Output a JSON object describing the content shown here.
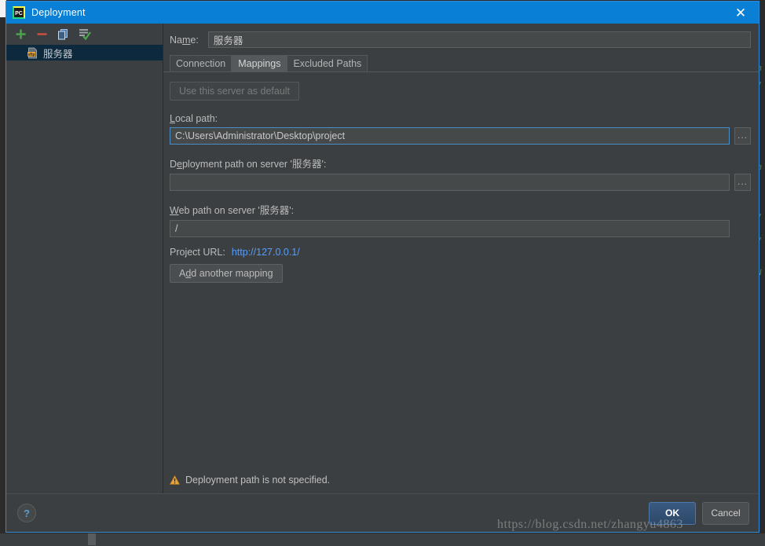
{
  "window": {
    "title": "Deployment",
    "app_icon": "pycharm-icon",
    "close_label": "✕"
  },
  "sidebar": {
    "toolbar": [
      {
        "name": "add-button",
        "label": "+"
      },
      {
        "name": "remove-button",
        "label": "−"
      },
      {
        "name": "copy-button",
        "label": "copy"
      },
      {
        "name": "set-default-button",
        "label": "set-default"
      }
    ],
    "servers": [
      {
        "label": "服务器",
        "icon": "sftp-icon",
        "selected": true
      }
    ]
  },
  "form": {
    "name_label_pre": "Na",
    "name_label_mn": "m",
    "name_label_post": "e:",
    "name_value": "服务器",
    "name_placeholder": ""
  },
  "tabs": [
    {
      "label": "Connection",
      "selected": false
    },
    {
      "label": "Mappings",
      "selected": true
    },
    {
      "label": "Excluded Paths",
      "selected": false
    }
  ],
  "mappings": {
    "use_default_button": "Use this server as default",
    "local_path": {
      "label_pre": "",
      "label_mn": "L",
      "label_post": "ocal path:",
      "value": "C:\\Users\\Administrator\\Desktop\\project",
      "browse_label": "..."
    },
    "deployment_path": {
      "label_pre": "D",
      "label_mn": "e",
      "label_post": "ployment path on server '服务器':",
      "value": "",
      "browse_label": "..."
    },
    "web_path": {
      "label_pre": "",
      "label_mn": "W",
      "label_post": "eb path on server '服务器':",
      "value": "/"
    },
    "project_url_label": "Project URL:",
    "project_url_value": "http://127.0.0.1/",
    "add_mapping_pre": "A",
    "add_mapping_mn": "d",
    "add_mapping_post": "d another mapping"
  },
  "warning": {
    "icon": "warning-triangle-icon",
    "text": "Deployment path is not specified."
  },
  "footer": {
    "help_label": "?",
    "ok_label": "OK",
    "cancel_label": "Cancel"
  },
  "watermark": {
    "text": "https://blog.csdn.net/zhangyu4863"
  },
  "backdrop": {
    "code_fragments": [
      "m",
      "'",
      "m",
      "'",
      "'",
      "N"
    ]
  },
  "colors": {
    "titlebar": "#0a7fd6",
    "dialog_bg": "#3c3f41",
    "selection": "#0d293e",
    "link": "#589df6",
    "focus_border": "#4b8ec7",
    "warning": "#e8a33d",
    "add_icon": "#46a546",
    "remove_icon": "#cc4b3c"
  }
}
